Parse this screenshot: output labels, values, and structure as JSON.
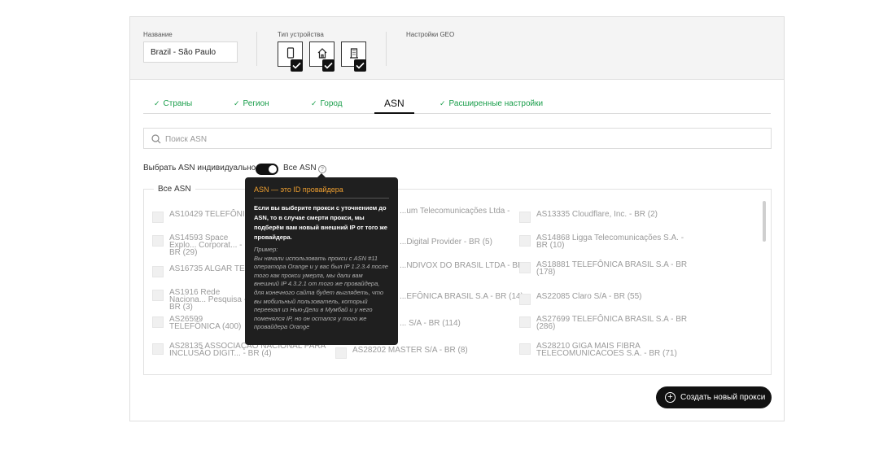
{
  "form": {
    "name_label": "Название",
    "name_value": "Brazil - São Paulo",
    "device_label": "Тип устройства",
    "geo_label": "Настройки GEO",
    "devices": [
      {
        "icon": "mobile-icon",
        "checked": true
      },
      {
        "icon": "home-icon",
        "checked": true
      },
      {
        "icon": "office-building-icon",
        "checked": true
      }
    ]
  },
  "tabs": [
    {
      "label": "Страны",
      "done": true
    },
    {
      "label": "Регион",
      "done": true
    },
    {
      "label": "Город",
      "done": true
    },
    {
      "label": "ASN",
      "active": true
    },
    {
      "label": "Расширенные настройки",
      "done": true
    }
  ],
  "search": {
    "placeholder": "Поиск ASN"
  },
  "toggle": {
    "left_label": "Выбрать ASN индивидуально",
    "right_label": "Все ASN",
    "on": true
  },
  "asn": {
    "legend": "Все ASN",
    "items": [
      "AS10429 TELEFÔNICA",
      "...um Telecomunicações Ltda -",
      "AS13335 Cloudflare, Inc. - BR (2)",
      "AS14593 Space Explo... Corporat... - BR (29)",
      "...Digital Provider - BR (5)",
      "AS14868 Ligga Telecomunicações S.A. - BR (10)",
      "AS16735 ALGAR TELE",
      "...NDIVOX DO BRASIL LTDA - BR",
      "AS18881 TELEFÔNICA BRASIL S.A - BR (178)",
      "AS1916 Rede Naciona... Pesquisa - BR (3)",
      "...EFÔNICA BRASIL S.A - BR (14)",
      "AS22085 Claro S/A - BR (55)",
      "AS26599 TELEFÔNICA (400)",
      "... S/A - BR (114)",
      "AS27699 TELEFÔNICA BRASIL S.A - BR (286)",
      "AS28135 ASSOCIAÇÃO NACIONAL PARA INCLUSÃO DIGIT... - BR (4)",
      "AS28202 MASTER S/A - BR (8)",
      "AS28210 GIGA MAIS FIBRA TELECOMUNICACOES S.A. - BR (71)"
    ]
  },
  "tooltip": {
    "title": "ASN — это ID провайдера",
    "body": "Если вы выберите прокси с уточнением до ASN, то в случае смерти прокси, мы подберём вам новый внешний IP от того же провайдера.",
    "example_title": "Пример:",
    "example": "Вы начали использовать прокси с ASN #11 оператора Orange и у вас был IP 1.2.3.4 после того как прокси умерла, мы дали вам внешний IP 4.3.2.1 от того же провайдера, для конечного сайта будет выглядеть, что вы мобильный пользователь, который переехал из Нью-Дели в Мумбай и у него поменялся IP, но он остался у того же провайдера Orange"
  },
  "create_button": "Создать новый прокси"
}
